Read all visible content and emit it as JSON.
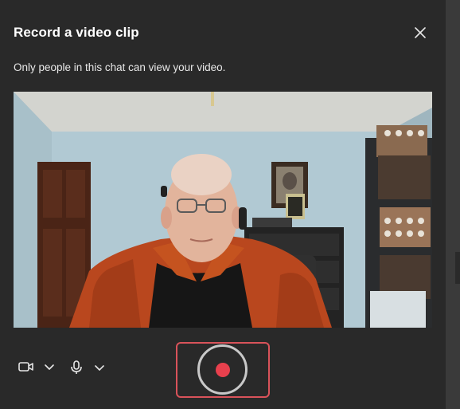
{
  "dialog": {
    "title": "Record a video clip",
    "subtitle": "Only people in this chat can view your video."
  },
  "icons": {
    "close": "close-icon",
    "camera": "video-camera-icon",
    "camera_chevron": "chevron-down-icon",
    "mic": "microphone-icon",
    "mic_chevron": "chevron-down-icon"
  },
  "colors": {
    "dialog_bg": "#292929",
    "record_dot": "#e8404d",
    "record_ring": "#c8c8c8",
    "highlight_border": "#d9535a"
  }
}
